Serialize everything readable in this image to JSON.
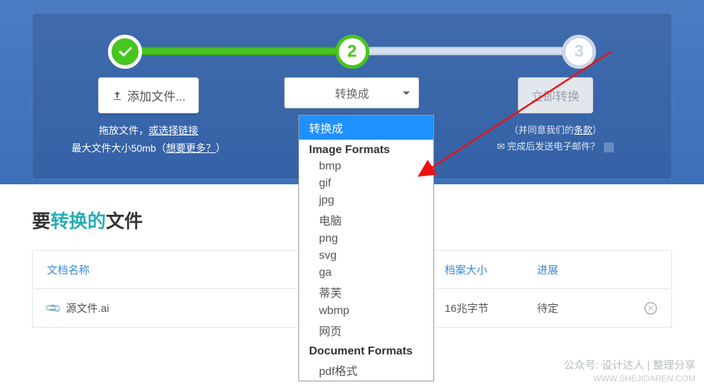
{
  "steps": {
    "step2": "2",
    "step3": "3"
  },
  "add_files": {
    "button": "添加文件...",
    "hint_drag": "拖放文件，",
    "hint_link": "或选择链接",
    "max_prefix": "最大文件大小50mb（",
    "max_link": "想要更多？",
    "max_suffix": "）"
  },
  "convert": {
    "select_placeholder": "转换成",
    "options": {
      "selected": "转换成",
      "group1": "Image Formats",
      "items1": [
        "bmp",
        "gif",
        "jpg",
        "电脑",
        "png",
        "svg",
        "ga",
        "蒂芙",
        "wbmp",
        "网页"
      ],
      "group2": "Document Formats",
      "items2": [
        "pdf格式"
      ]
    }
  },
  "action": {
    "convert_now": "立即转换",
    "terms_prefix": "（并同意我们的",
    "terms_link": "条款",
    "terms_suffix": "）",
    "email_after": "✉ 完成后发送电子邮件？"
  },
  "files": {
    "heading_pre": "要",
    "heading_mid": "转换的",
    "heading_post": "文件",
    "col_name": "文档名称",
    "col_size": "档案大小",
    "col_prog": "进展",
    "row1": {
      "name": "源文件.ai",
      "size": "16兆字节",
      "prog": "待定"
    }
  },
  "watermark": {
    "zh": "公众号: 设计达人 | 整理分享",
    "en": "WWW.SHEJIDAREN.COM"
  }
}
